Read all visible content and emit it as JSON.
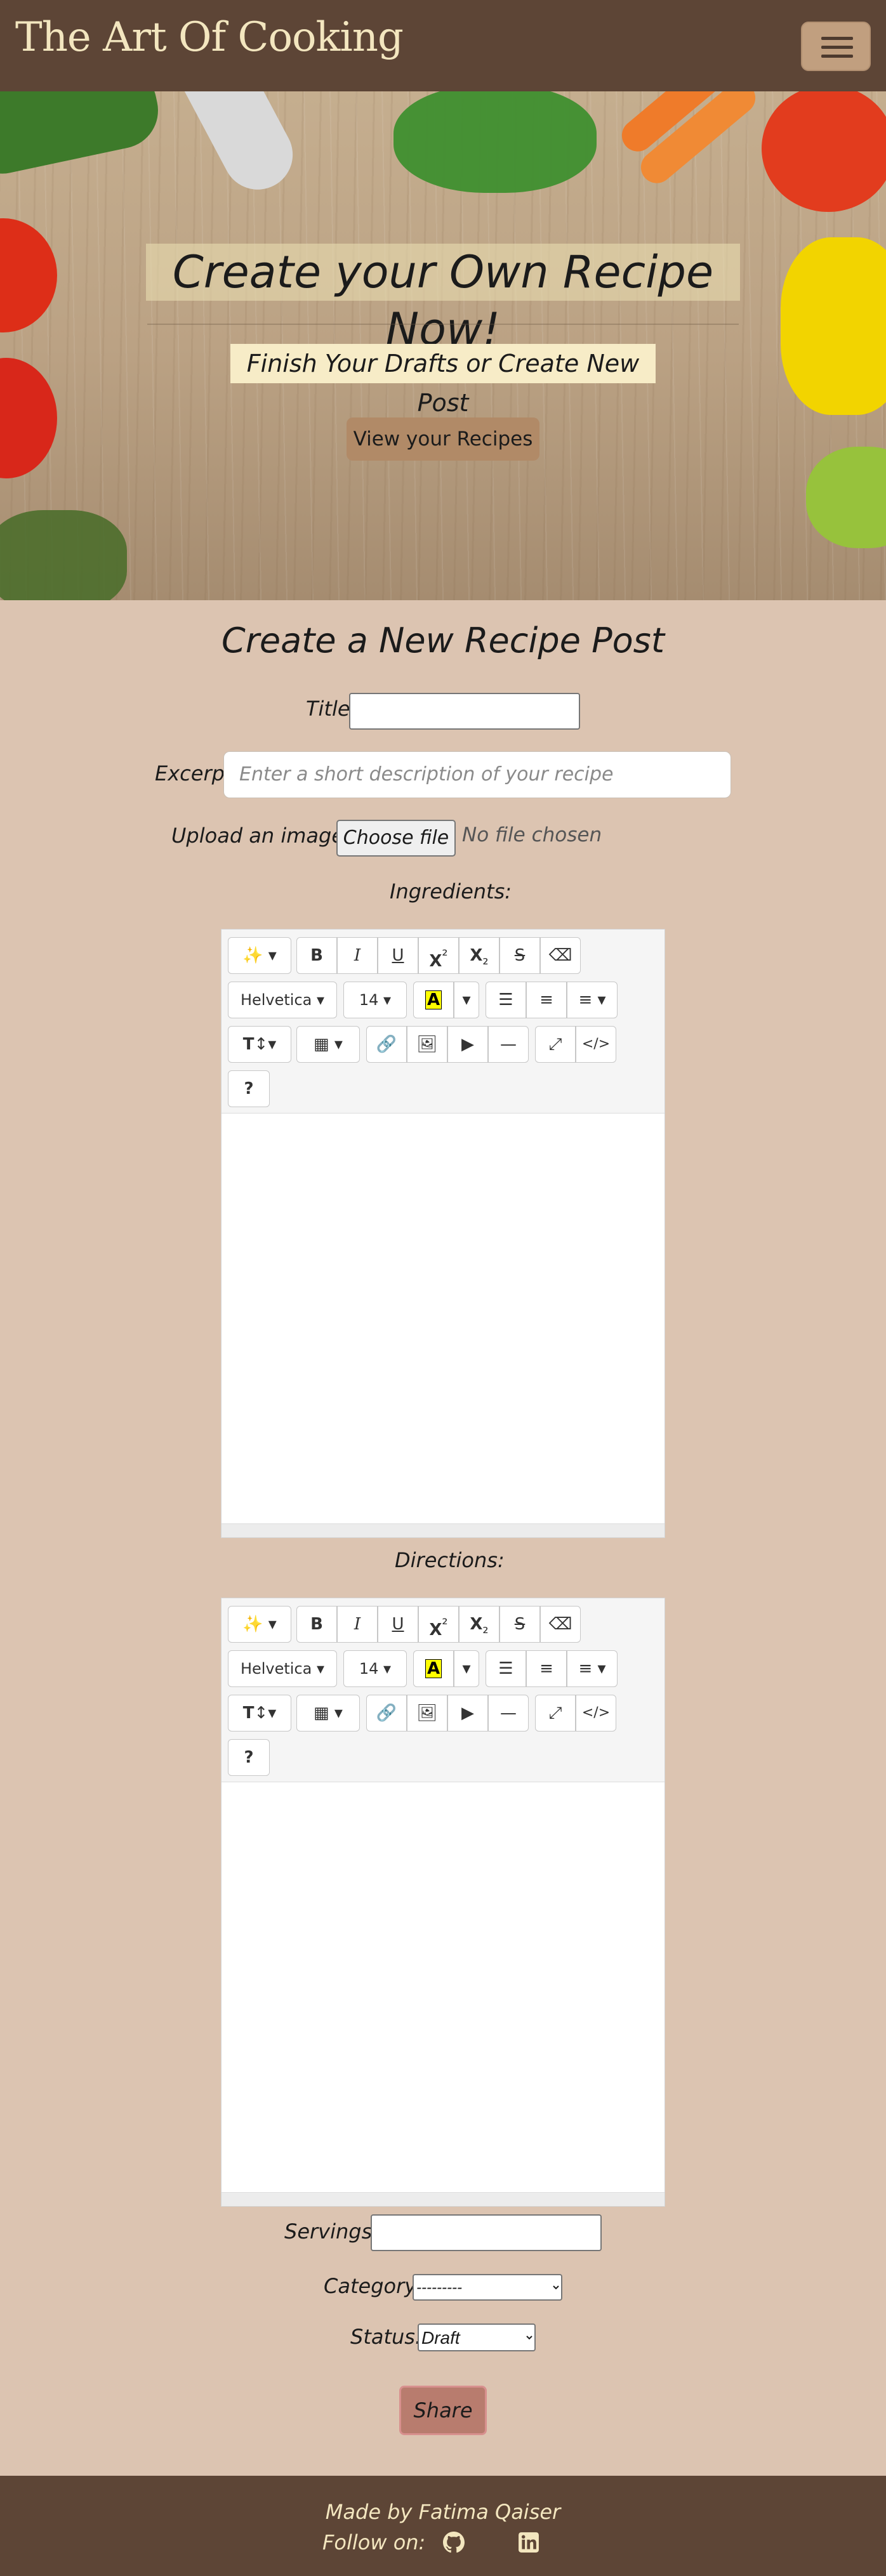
{
  "navbar": {
    "brand": "The Art Of Cooking",
    "toggle_icon": "hamburger-menu-icon"
  },
  "hero": {
    "title": "Create your Own Recipe Now!",
    "subtitle": "Finish Your Drafts or Create New Post",
    "button_label": "View your Recipes"
  },
  "form": {
    "heading": "Create a New Recipe Post",
    "title_label": "Title:",
    "title_value": "",
    "excerpt_label": "Excerpt:",
    "excerpt_placeholder": "Enter a short description of your recipe",
    "image_label": "Upload an image:",
    "file_button": "Choose file",
    "file_status": "No file chosen",
    "ingredients_label": "Ingredients:",
    "directions_label": "Directions:",
    "servings_label": "Servings:",
    "servings_value": "",
    "category_label": "Category:",
    "category_selected": "---------",
    "status_label": "Status:",
    "status_selected": "Draft",
    "share_button": "Share"
  },
  "editor": {
    "font_name": "Helvetica",
    "font_size": "14",
    "help": "?",
    "code": "</>"
  },
  "footer": {
    "made_by": "Made by Fatima Qaiser",
    "follow_label": "Follow on:",
    "icons": [
      "github-icon",
      "linkedin-icon"
    ]
  },
  "colors": {
    "navbar": "#5d4536",
    "page_bg": "#dcc4b1",
    "brand_text": "#f3e6bf",
    "accent_button": "#b18a67",
    "share_button": "#b87c6e"
  }
}
